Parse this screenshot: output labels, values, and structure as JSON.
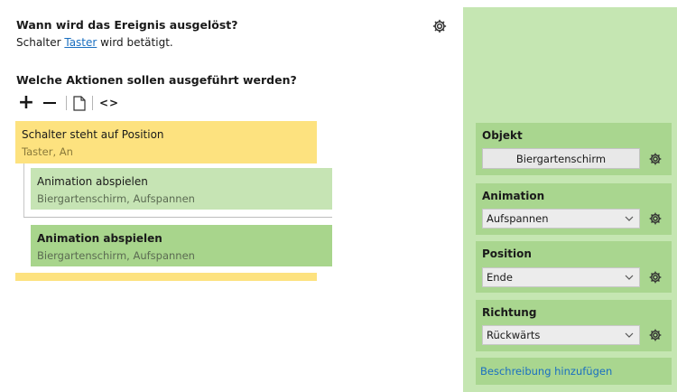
{
  "trigger": {
    "question": "Wann wird das Ereignis ausgelöst?",
    "prefix": "Schalter",
    "link": "Taster",
    "suffix": "wird betätigt."
  },
  "actions": {
    "question": "Welche Aktionen sollen ausgeführt werden?",
    "toolbar": {
      "add": "+",
      "code": "<>"
    }
  },
  "condition": {
    "title": "Schalter steht auf Position",
    "subtitle": "Taster, An"
  },
  "action_items": [
    {
      "title": "Animation abspielen",
      "subtitle": "Biergartenschirm, Aufspannen"
    },
    {
      "title": "Animation abspielen",
      "subtitle": "Biergartenschirm, Aufspannen"
    }
  ],
  "properties": {
    "object": {
      "label": "Objekt",
      "value": "Biergartenschirm"
    },
    "animation": {
      "label": "Animation",
      "value": "Aufspannen"
    },
    "position": {
      "label": "Position",
      "value": "Ende"
    },
    "direction": {
      "label": "Richtung",
      "value": "Rückwärts"
    },
    "description_link": "Beschreibung hinzufügen"
  },
  "colors": {
    "condition": "#fde27f",
    "action_light": "#c6e4b4",
    "action_selected": "#a8d58c",
    "panel": "#c5e6b2",
    "group": "#a9d68f",
    "link": "#1a6fc0"
  }
}
